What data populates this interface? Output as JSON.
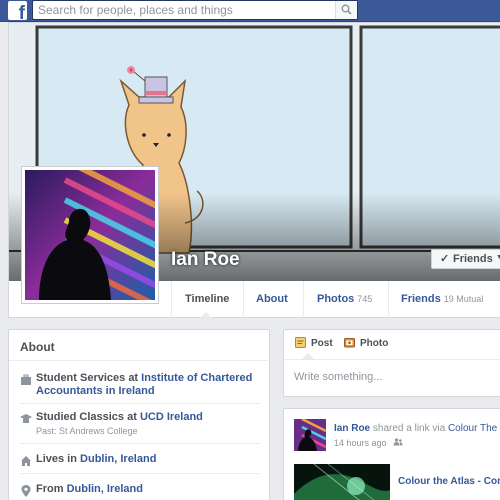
{
  "topbar": {
    "logo": "f",
    "search_placeholder": "Search for people, places and things",
    "search_icon": "search-icon"
  },
  "profile": {
    "name": "Ian Roe",
    "friends_button": "Friends",
    "friends_check": "✓",
    "tabs": [
      {
        "label": "Timeline",
        "count": ""
      },
      {
        "label": "About",
        "count": ""
      },
      {
        "label": "Photos",
        "count": "745"
      },
      {
        "label": "Friends",
        "count": "19 Mutual"
      }
    ]
  },
  "about": {
    "title": "About",
    "rows": [
      {
        "icon": "briefcase-icon",
        "text": "Student Services at ",
        "link": "Institute of Chartered Accountants in Ireland",
        "sub": ""
      },
      {
        "icon": "graduation-cap-icon",
        "text": "Studied Classics at ",
        "link": "UCD Ireland",
        "sub": "Past: St Andrews College"
      },
      {
        "icon": "home-icon",
        "text": "Lives in ",
        "link": "Dublin, Ireland",
        "sub": ""
      },
      {
        "icon": "location-pin-icon",
        "text": "From ",
        "link": "Dublin, Ireland",
        "sub": ""
      }
    ]
  },
  "composer": {
    "tab_post": "Post",
    "tab_photo": "Photo",
    "placeholder": "Write something..."
  },
  "story": {
    "author": "Ian Roe",
    "action": " shared a link via ",
    "via": "Colour The",
    "time": "14 hours ago",
    "audience_icon": "friends-audience-icon",
    "link_title": "Colour the Atlas - Com"
  },
  "colors": {
    "brand": "#3b5998",
    "link": "#365899",
    "background": "#e9ebee"
  }
}
